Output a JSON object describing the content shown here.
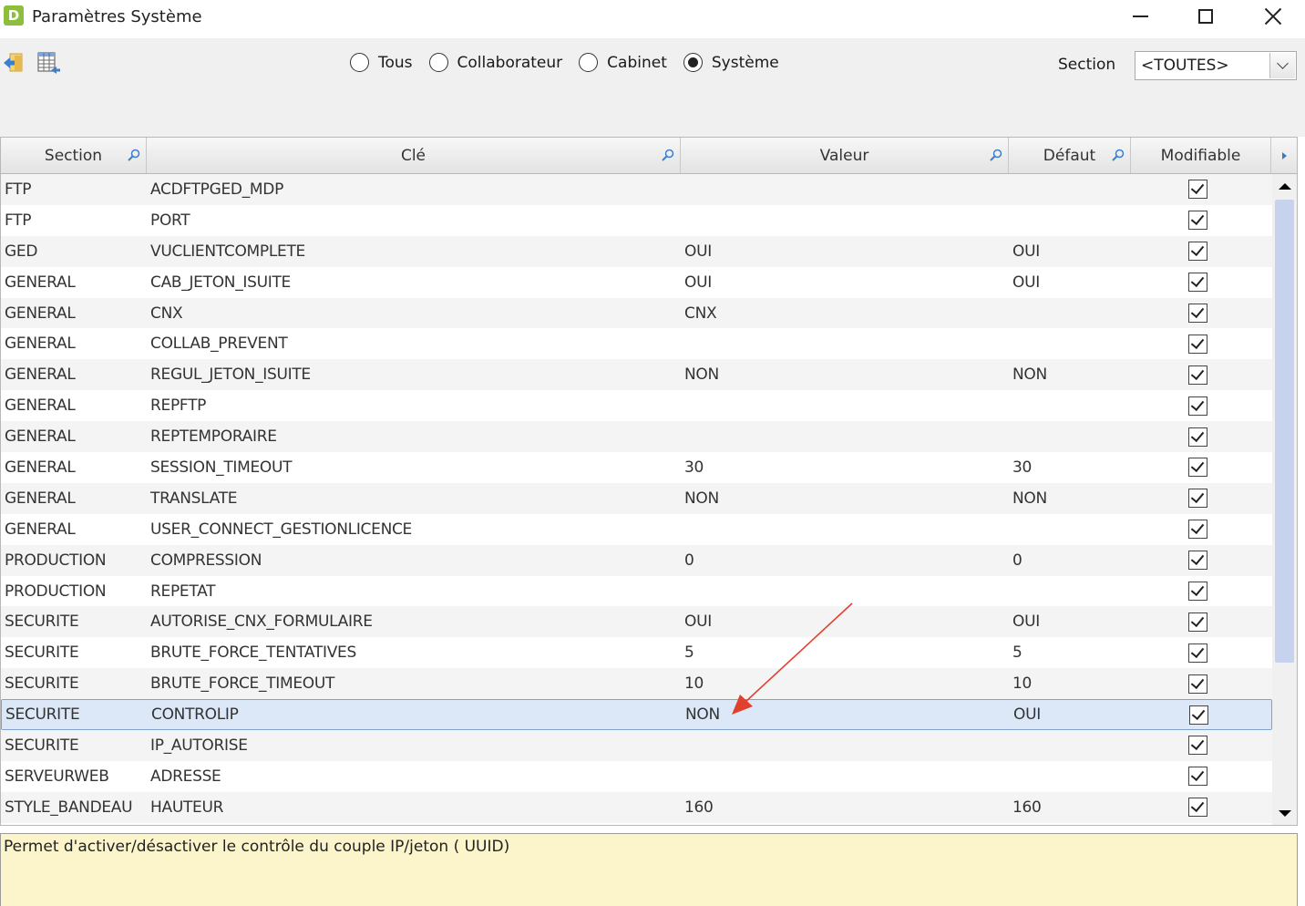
{
  "window": {
    "icon_letter": "D",
    "title": "Paramètres Système"
  },
  "toolbar": {
    "icons": [
      "exit-icon",
      "grid-export-icon"
    ],
    "filter_options": [
      {
        "label": "Tous",
        "selected": false
      },
      {
        "label": "Collaborateur",
        "selected": false
      },
      {
        "label": "Cabinet",
        "selected": false
      },
      {
        "label": "Système",
        "selected": true
      }
    ],
    "section_label": "Section",
    "section_value": "<TOUTES>"
  },
  "grid": {
    "columns": [
      "Section",
      "Clé",
      "Valeur",
      "Défaut",
      "Modifiable"
    ],
    "rows": [
      {
        "section": "FTP",
        "cle": "ACDFTPGED_MDP",
        "valeur": "",
        "defaut": "",
        "modifiable": true
      },
      {
        "section": "FTP",
        "cle": "PORT",
        "valeur": "",
        "defaut": "",
        "modifiable": true
      },
      {
        "section": "GED",
        "cle": "VUCLIENTCOMPLETE",
        "valeur": "OUI",
        "defaut": "OUI",
        "modifiable": true
      },
      {
        "section": "GENERAL",
        "cle": "CAB_JETON_ISUITE",
        "valeur": "OUI",
        "defaut": "OUI",
        "modifiable": true
      },
      {
        "section": "GENERAL",
        "cle": "CNX",
        "valeur": "CNX",
        "defaut": "",
        "modifiable": true
      },
      {
        "section": "GENERAL",
        "cle": "COLLAB_PREVENT",
        "valeur": "",
        "defaut": "",
        "modifiable": true
      },
      {
        "section": "GENERAL",
        "cle": "REGUL_JETON_ISUITE",
        "valeur": "NON",
        "defaut": "NON",
        "modifiable": true
      },
      {
        "section": "GENERAL",
        "cle": "REPFTP",
        "valeur": "",
        "defaut": "",
        "modifiable": true
      },
      {
        "section": "GENERAL",
        "cle": "REPTEMPORAIRE",
        "valeur": "",
        "defaut": "",
        "modifiable": true
      },
      {
        "section": "GENERAL",
        "cle": "SESSION_TIMEOUT",
        "valeur": "30",
        "defaut": "30",
        "modifiable": true
      },
      {
        "section": "GENERAL",
        "cle": "TRANSLATE",
        "valeur": "NON",
        "defaut": "NON",
        "modifiable": true
      },
      {
        "section": "GENERAL",
        "cle": "USER_CONNECT_GESTIONLICENCE",
        "valeur": "",
        "defaut": "",
        "modifiable": true
      },
      {
        "section": "PRODUCTION",
        "cle": "COMPRESSION",
        "valeur": "0",
        "defaut": "0",
        "modifiable": true
      },
      {
        "section": "PRODUCTION",
        "cle": "REPETAT",
        "valeur": "",
        "defaut": "",
        "modifiable": true
      },
      {
        "section": "SECURITE",
        "cle": "AUTORISE_CNX_FORMULAIRE",
        "valeur": "OUI",
        "defaut": "OUI",
        "modifiable": true
      },
      {
        "section": "SECURITE",
        "cle": "BRUTE_FORCE_TENTATIVES",
        "valeur": "5",
        "defaut": "5",
        "modifiable": true
      },
      {
        "section": "SECURITE",
        "cle": "BRUTE_FORCE_TIMEOUT",
        "valeur": "10",
        "defaut": "10",
        "modifiable": true
      },
      {
        "section": "SECURITE",
        "cle": "CONTROLIP",
        "valeur": "NON",
        "defaut": "OUI",
        "modifiable": true,
        "selected": true
      },
      {
        "section": "SECURITE",
        "cle": "IP_AUTORISE",
        "valeur": "",
        "defaut": "",
        "modifiable": true
      },
      {
        "section": "SERVEURWEB",
        "cle": "ADRESSE",
        "valeur": "",
        "defaut": "",
        "modifiable": true
      },
      {
        "section": "STYLE_BANDEAU",
        "cle": "HAUTEUR",
        "valeur": "160",
        "defaut": "160",
        "modifiable": true
      }
    ]
  },
  "description": "Permet d'activer/désactiver le contrôle du couple IP/jeton ( UUID)",
  "colors": {
    "annotation_arrow": "#e0412f",
    "selected_row": "#dce8f8",
    "description_bg": "#fcf5cc",
    "app_icon": "#8cbd3c"
  }
}
